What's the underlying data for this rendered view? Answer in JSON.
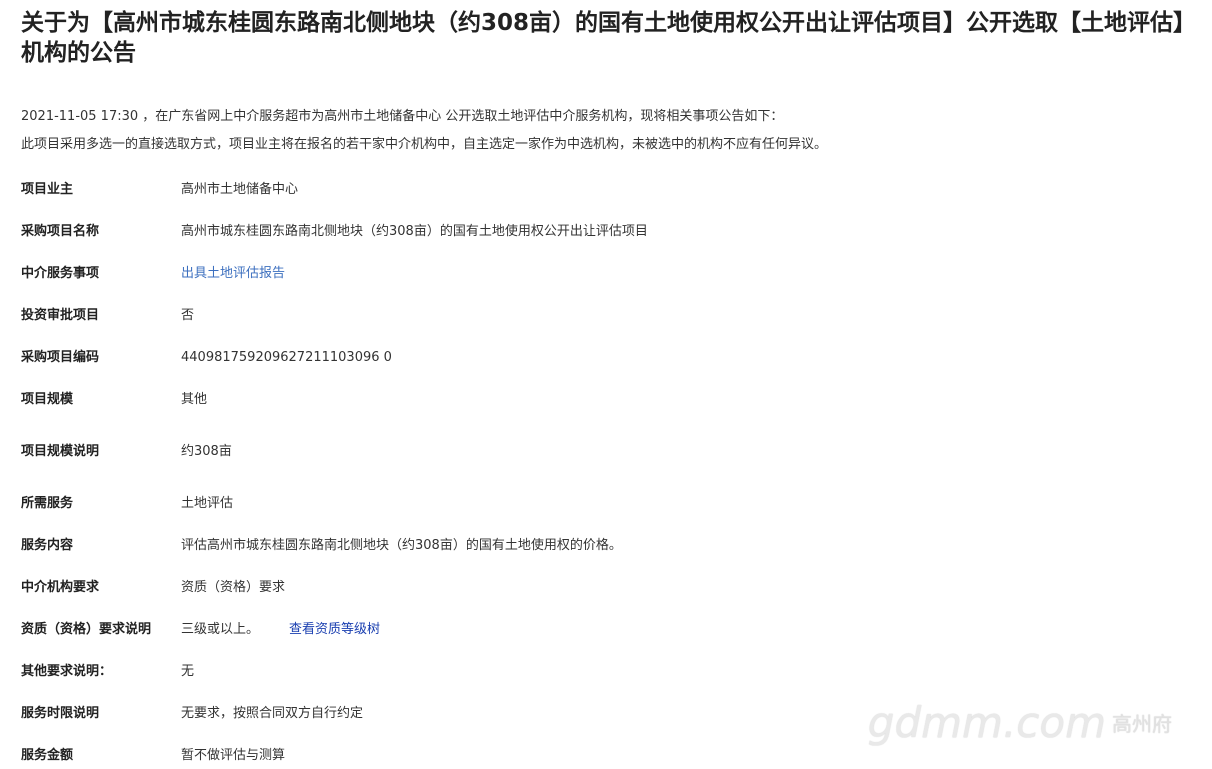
{
  "notice": {
    "title": "关于为【高州市城东桂圆东路南北侧地块（约308亩）的国有土地使用权公开出让评估项目】公开选取【土地评估】机构的公告",
    "intro_line1": "2021-11-05 17:30 ，在广东省网上中介服务超市为高州市土地储备中心 公开选取土地评估中介服务机构，现将相关事项公告如下：",
    "intro_line2": "此项目采用多选一的直接选取方式，项目业主将在报名的若干家中介机构中，自主选定一家作为中选机构，未被选中的机构不应有任何异议。"
  },
  "details": [
    {
      "label": "项目业主",
      "value": "高州市土地储备中心"
    },
    {
      "label": "采购项目名称",
      "value": "高州市城东桂圆东路南北侧地块（约308亩）的国有土地使用权公开出让评估项目"
    },
    {
      "label": "中介服务事项",
      "value": "出具土地评估报告"
    },
    {
      "label": "投资审批项目",
      "value": "否"
    },
    {
      "label": "采购项目编码",
      "value": "440981759209627211103096 0"
    },
    {
      "label": "项目规模",
      "value": "其他"
    },
    {
      "label": "项目规模说明",
      "value": "约308亩"
    },
    {
      "label": "所需服务",
      "value": "土地评估"
    },
    {
      "label": "服务内容",
      "value": "评估高州市城东桂圆东路南北侧地块（约308亩）的国有土地使用权的价格。"
    },
    {
      "label": "中介机构要求",
      "value": "资质（资格）要求"
    },
    {
      "label": "资质（资格）要求说明",
      "value": "三级或以上。",
      "link": "查看资质等级树"
    },
    {
      "label": "其他要求说明：",
      "value": "无"
    },
    {
      "label": "服务时限说明",
      "value": "无要求，按照合同双方自行约定"
    },
    {
      "label": "服务金额",
      "value": "暂不做评估与测算"
    }
  ],
  "watermark": {
    "text": "gdmm.com",
    "sub": "高州府"
  }
}
